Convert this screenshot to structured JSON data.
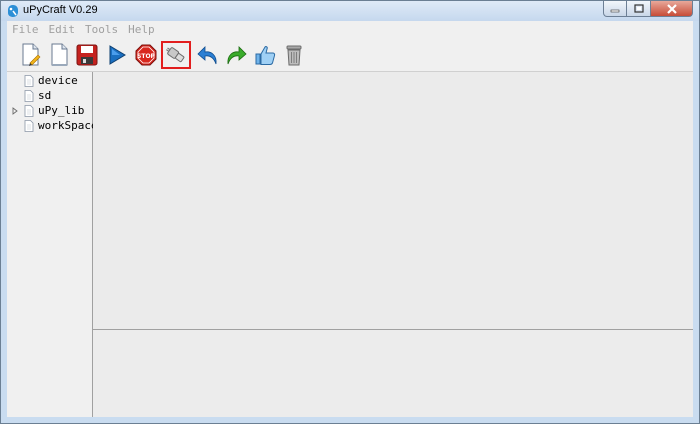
{
  "window": {
    "title": "uPyCraft V0.29"
  },
  "menu": [
    {
      "label": "File"
    },
    {
      "label": "Edit"
    },
    {
      "label": "Tools"
    },
    {
      "label": "Help"
    }
  ],
  "toolbar": {
    "buttons": [
      {
        "icon": "new-file-icon"
      },
      {
        "icon": "open-file-icon"
      },
      {
        "icon": "save-icon"
      },
      {
        "icon": "run-icon"
      },
      {
        "icon": "stop-icon"
      },
      {
        "icon": "connect-icon",
        "highlighted": true
      },
      {
        "icon": "undo-icon"
      },
      {
        "icon": "redo-icon"
      },
      {
        "icon": "syntax-check-icon"
      },
      {
        "icon": "clear-icon"
      }
    ],
    "highlight_color": "#e21e1e"
  },
  "sidebar": {
    "items": [
      {
        "label": "device",
        "expandable": false
      },
      {
        "label": "sd",
        "expandable": false
      },
      {
        "label": "uPy_lib",
        "expandable": true
      },
      {
        "label": "workSpace",
        "expandable": false
      }
    ]
  }
}
